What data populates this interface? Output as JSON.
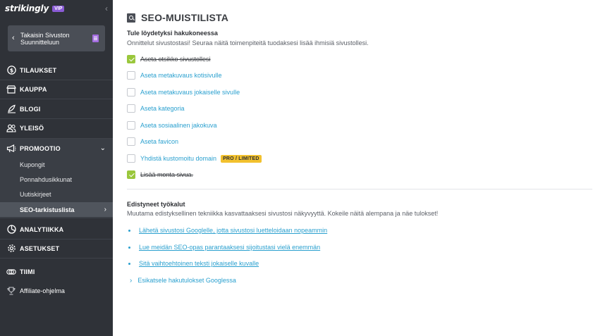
{
  "sidebar": {
    "brand": "strikingly",
    "vip_badge": "VIP",
    "back_label": "Takaisin Sivuston Suunnitteluun",
    "items": [
      {
        "label": "TILAUKSET",
        "icon": "dollar-circle-icon"
      },
      {
        "label": "KAUPPA",
        "icon": "store-icon"
      },
      {
        "label": "BLOGI",
        "icon": "quill-icon"
      },
      {
        "label": "YLEISÖ",
        "icon": "people-icon"
      },
      {
        "label": "PROMOOTIO",
        "icon": "megaphone-icon"
      },
      {
        "label": "ANALYTIIKKA",
        "icon": "pie-chart-icon"
      },
      {
        "label": "ASETUKSET",
        "icon": "gear-icon"
      },
      {
        "label": "TIIMI",
        "icon": "team-icon"
      },
      {
        "label": "Affiliate-ohjelma",
        "icon": "trophy-icon"
      }
    ],
    "promo_sub": [
      {
        "label": "Kupongit"
      },
      {
        "label": "Ponnahdusikkunat"
      },
      {
        "label": "Uutiskirjeet"
      },
      {
        "label": "SEO-tarkistuslista"
      }
    ]
  },
  "main": {
    "title": "SEO-MUISTILISTA",
    "section1": {
      "title": "Tule löydetyksi hakukoneessa",
      "desc": "Onnittelut sivustostasi! Seuraa näitä toimenpiteitä tuodaksesi lisää ihmisiä sivustollesi."
    },
    "checklist": [
      {
        "label": "Aseta otsikko sivustollesi",
        "done": true
      },
      {
        "label": "Aseta metakuvaus kotisivulle",
        "done": false
      },
      {
        "label": "Aseta metakuvaus jokaiselle sivulle",
        "done": false
      },
      {
        "label": "Aseta kategoria",
        "done": false
      },
      {
        "label": "Aseta sosiaalinen jakokuva",
        "done": false
      },
      {
        "label": "Aseta favicon",
        "done": false
      },
      {
        "label": "Yhdistä kustomoitu domain",
        "done": false,
        "badge": "PRO / LIMITED"
      },
      {
        "label": "Lisää monta sivua.",
        "done": true
      }
    ],
    "section2": {
      "title": "Edistyneet työkalut",
      "desc": "Muutama edistyksellinen tekniikka kasvattaaksesi sivustosi näkyvyyttä. Kokeile näitä alempana ja näe tulokset!"
    },
    "links": [
      {
        "label": "Lähetä sivustosi Googlelle, jotta sivustosi luetteloidaan nopeammin"
      },
      {
        "label": "Lue meidän SEO-opas parantaaksesi sijoitustasi vielä enemmän"
      },
      {
        "label": "Sitä vaihtoehtoinen teksti jokaiselle kuvalle"
      }
    ],
    "expand_label": "Esikatsele hakutulokset Googlessa"
  },
  "colors": {
    "sidebar_bg": "#2f3238",
    "link": "#2aa0cf",
    "check_green": "#9ac73c",
    "badge_yellow": "#f2c12e",
    "vip_purple": "#8a5bd6"
  }
}
